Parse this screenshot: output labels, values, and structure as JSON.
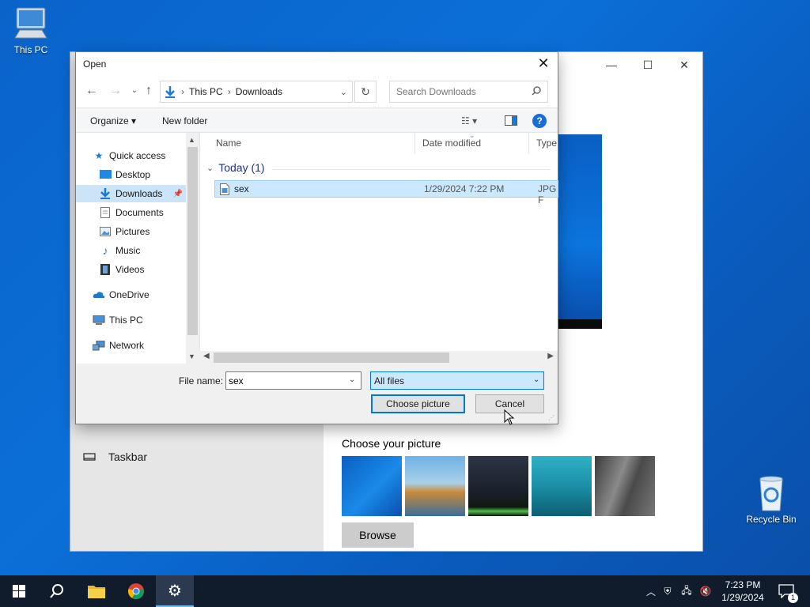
{
  "desktop": {
    "this_pc_label": "This PC",
    "recycle_bin_label": "Recycle Bin"
  },
  "settings": {
    "taskbar_label": "Taskbar",
    "choose_label": "Choose your picture",
    "browse_label": "Browse",
    "thumbnails": [
      {
        "name": "windows-hero",
        "color": "#0a78d6"
      },
      {
        "name": "beach-rocks",
        "color": "#3d8fc2"
      },
      {
        "name": "night-tent",
        "color": "#1d2430"
      },
      {
        "name": "underwater-swimmer",
        "color": "#1a8fa6"
      },
      {
        "name": "rock-cliff",
        "color": "#5e5e5e"
      }
    ]
  },
  "dialog": {
    "title": "Open",
    "breadcrumb": [
      "This PC",
      "Downloads"
    ],
    "search_placeholder": "Search Downloads",
    "organize_label": "Organize ▾",
    "new_folder_label": "New folder",
    "nav_items": [
      {
        "label": "Quick access",
        "icon": "star-icon"
      },
      {
        "label": "Desktop",
        "icon": "desktop-icon",
        "pinned": true
      },
      {
        "label": "Downloads",
        "icon": "download-icon",
        "pinned": true,
        "selected": true
      },
      {
        "label": "Documents",
        "icon": "document-icon",
        "pinned": true
      },
      {
        "label": "Pictures",
        "icon": "picture-icon",
        "pinned": true
      },
      {
        "label": "Music",
        "icon": "music-icon"
      },
      {
        "label": "Videos",
        "icon": "video-icon"
      },
      {
        "label": "OneDrive",
        "icon": "cloud-icon"
      },
      {
        "label": "This PC",
        "icon": "computer-icon"
      },
      {
        "label": "Network",
        "icon": "network-icon"
      }
    ],
    "columns": {
      "name": "Name",
      "date": "Date modified",
      "type": "Type"
    },
    "group_label": "Today (1)",
    "files": [
      {
        "name": "sex",
        "date": "1/29/2024 7:22 PM",
        "type": "JPG F"
      }
    ],
    "file_name_label": "File name:",
    "file_name_value": "sex",
    "filter_value": "All files",
    "choose_button": "Choose picture",
    "cancel_button": "Cancel"
  },
  "taskbar": {
    "time": "7:23 PM",
    "date": "1/29/2024",
    "notification_count": "1"
  }
}
